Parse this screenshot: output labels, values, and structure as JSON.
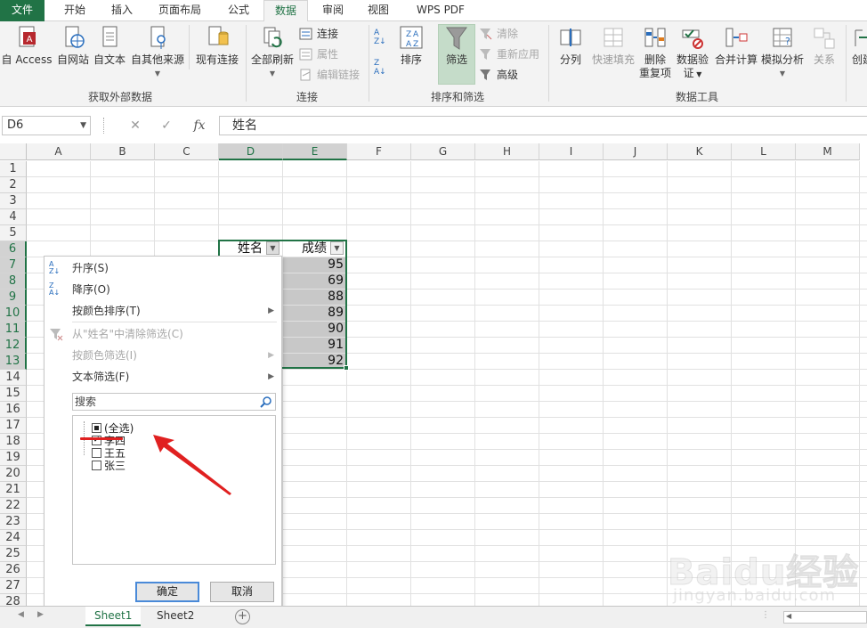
{
  "ribbon_tabs": [
    "文件",
    "开始",
    "插入",
    "页面布局",
    "公式",
    "数据",
    "审阅",
    "视图",
    "WPS PDF"
  ],
  "ribbon": {
    "groups": {
      "external": "获取外部数据",
      "connections": "连接",
      "sort_filter": "排序和筛选",
      "data_tools": "数据工具"
    },
    "buttons": {
      "access": "自 Access",
      "web": "自网站",
      "text": "自文本",
      "other_line1": "自其他来源",
      "existing": "现有连接",
      "refresh_all": "全部刷新",
      "connections": "连接",
      "properties": "属性",
      "edit_links": "编辑链接",
      "sort": "排序",
      "filter": "筛选",
      "clear": "清除",
      "reapply": "重新应用",
      "advanced": "高级",
      "split": "分列",
      "flash_fill": "快速填充",
      "remove_dup_1": "删除",
      "remove_dup_2": "重复项",
      "validation_1": "数据验",
      "validation_2": "证",
      "consolidate": "合并计算",
      "whatif": "模拟分析",
      "relations": "关系",
      "create": "创建"
    }
  },
  "formula_bar": {
    "name_box": "D6",
    "cancel": "✕",
    "enter": "✓",
    "fx": "fx",
    "content": "姓名"
  },
  "grid": {
    "columns": [
      "A",
      "B",
      "C",
      "D",
      "E",
      "F",
      "G",
      "H",
      "I",
      "J",
      "K",
      "L",
      "M"
    ],
    "rows": [
      "1",
      "2",
      "3",
      "4",
      "5",
      "6",
      "7",
      "8",
      "9",
      "10",
      "11",
      "12",
      "13",
      "14",
      "15",
      "16",
      "17",
      "18",
      "19",
      "20",
      "21",
      "22",
      "23",
      "24",
      "25",
      "26",
      "27",
      "28"
    ],
    "header_name": "姓名",
    "header_score": "成绩",
    "scores": [
      "95",
      "69",
      "88",
      "89",
      "90",
      "91",
      "92"
    ]
  },
  "filter_menu": {
    "sort_asc": "升序(S)",
    "sort_desc": "降序(O)",
    "sort_by_color": "按颜色排序(T)",
    "clear_filter": "从\"姓名\"中清除筛选(C)",
    "filter_by_color": "按颜色筛选(I)",
    "text_filter": "文本筛选(F)",
    "search_placeholder": "搜索",
    "items": [
      {
        "label": "(全选)",
        "state": "partial"
      },
      {
        "label": "李四",
        "state": "checked"
      },
      {
        "label": "王五",
        "state": "unchecked"
      },
      {
        "label": "张三",
        "state": "unchecked"
      }
    ],
    "ok": "确定",
    "cancel": "取消"
  },
  "sheet_tabs": [
    "Sheet1",
    "Sheet2"
  ],
  "watermark": {
    "main": "Baidu经验",
    "sub": "jingyan.baidu.com"
  },
  "colors": {
    "accent": "#217346",
    "annotation": "#e02020",
    "filter_active_bg": "#c5dcc9",
    "selected_cell_bg": "#c8c8c8"
  }
}
